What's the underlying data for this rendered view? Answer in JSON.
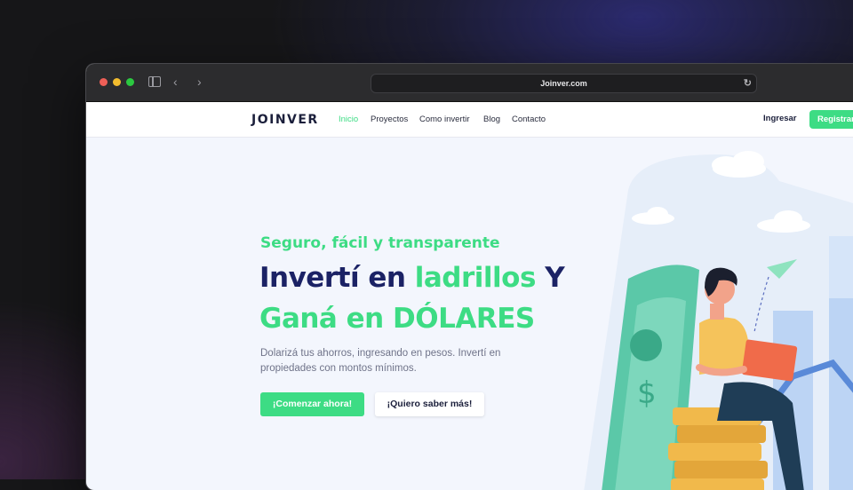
{
  "browser": {
    "url": "Joinver.com"
  },
  "navbar": {
    "logo": "JOINVER",
    "links": [
      "Inicio",
      "Proyectos",
      "Como invertir",
      "Blog",
      "Contacto"
    ],
    "login": "Ingresar",
    "register": "Registrarse"
  },
  "hero": {
    "tagline": "Seguro, fácil y transparente",
    "headline_line1_part1": "Invertí en ",
    "headline_line1_part2": "ladrillos",
    "headline_line1_part3": " Y",
    "headline_line2": "Ganá en DÓLARES",
    "description": "Dolarizá tus ahorros, ingresando en pesos. Invertí en propiedades con montos mínimos.",
    "primary_button": "¡Comenzar ahora!",
    "secondary_button": "¡Quiero saber más!"
  },
  "colors": {
    "accent": "#3ddc84",
    "navy": "#1b2265",
    "window_bg": "#f3f6fd"
  }
}
